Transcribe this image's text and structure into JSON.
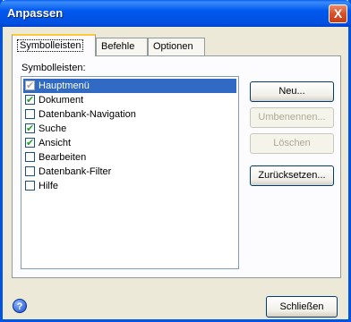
{
  "window": {
    "title": "Anpassen",
    "close_glyph": "X"
  },
  "tabs": [
    {
      "label": "Symbolleisten",
      "active": true
    },
    {
      "label": "Befehle",
      "active": false
    },
    {
      "label": "Optionen",
      "active": false
    }
  ],
  "panel": {
    "list_label": "Symbolleisten:",
    "items": [
      {
        "label": "Hauptmenü",
        "checked": true,
        "disabled": true,
        "selected": true
      },
      {
        "label": "Dokument",
        "checked": true,
        "disabled": false,
        "selected": false
      },
      {
        "label": "Datenbank-Navigation",
        "checked": false,
        "disabled": false,
        "selected": false
      },
      {
        "label": "Suche",
        "checked": true,
        "disabled": false,
        "selected": false
      },
      {
        "label": "Ansicht",
        "checked": true,
        "disabled": false,
        "selected": false
      },
      {
        "label": "Bearbeiten",
        "checked": false,
        "disabled": false,
        "selected": false
      },
      {
        "label": "Datenbank-Filter",
        "checked": false,
        "disabled": false,
        "selected": false
      },
      {
        "label": "Hilfe",
        "checked": false,
        "disabled": false,
        "selected": false
      }
    ],
    "buttons": {
      "new_label": "Neu...",
      "rename_label": "Umbenennen...",
      "delete_label": "Löschen",
      "reset_label": "Zurücksetzen..."
    }
  },
  "footer": {
    "help_glyph": "?",
    "close_label": "Schließen"
  },
  "colors": {
    "titlebar": "#0058ee",
    "selection": "#316ac5",
    "checkmark": "#21a121"
  }
}
